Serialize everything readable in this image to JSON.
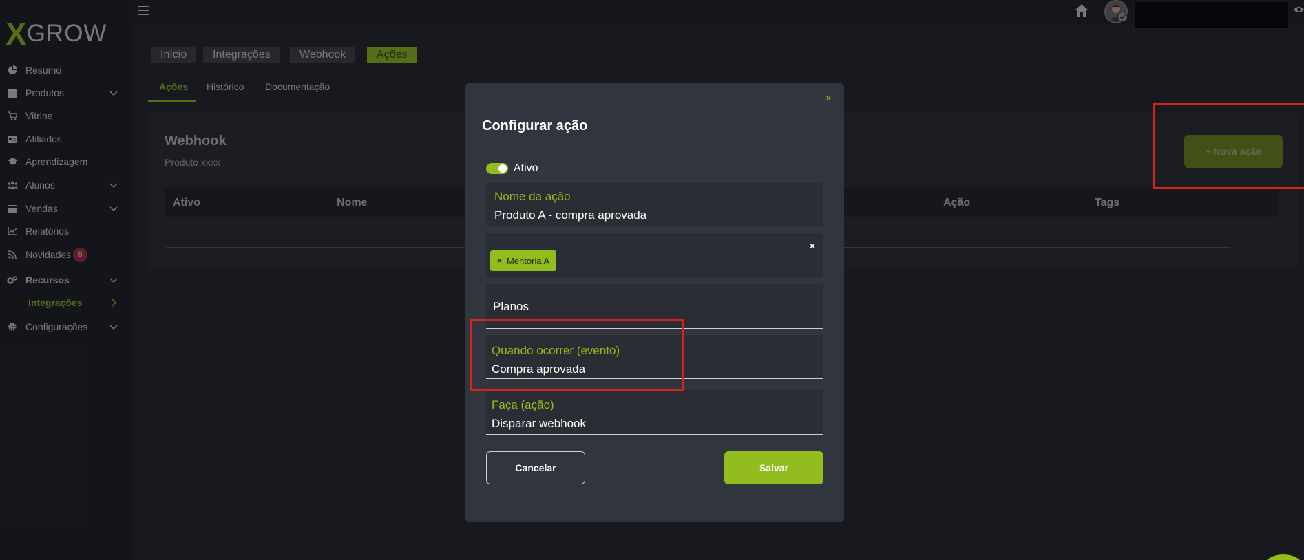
{
  "brand": {
    "logo_x": "X",
    "logo_rest": "GROW",
    "accent": "#93bc1e"
  },
  "sidebar": {
    "items": [
      {
        "label": "Resumo",
        "icon": "pie-chart-icon"
      },
      {
        "label": "Produtos",
        "icon": "box-icon"
      },
      {
        "label": "Vitrine",
        "icon": "cart-icon"
      },
      {
        "label": "Afiliados",
        "icon": "id-card-icon"
      },
      {
        "label": "Aprendizagem",
        "icon": "graduation-cap-icon"
      },
      {
        "label": "Alunos",
        "icon": "users-icon"
      },
      {
        "label": "Vendas",
        "icon": "wallet-icon"
      },
      {
        "label": "Relatórios",
        "icon": "line-chart-icon"
      },
      {
        "label": "Novidades",
        "icon": "rss-icon",
        "badge": "5"
      },
      {
        "label": "Recursos",
        "icon": "cogs-icon"
      },
      {
        "label": "Integrações"
      },
      {
        "label": "Configurações",
        "icon": "gear-icon"
      }
    ]
  },
  "breadcrumbs": [
    "Início",
    "Integrações",
    "Webhook",
    "Ações"
  ],
  "tabs": [
    "Ações",
    "Histórico",
    "Documentação"
  ],
  "card": {
    "title": "Webhook",
    "subtitle": "Produto xxxx",
    "columns": [
      "Ativo",
      "Nome",
      "Ação",
      "Tags"
    ],
    "new_action_button": "+ Nova ação"
  },
  "modal": {
    "title": "Configurar ação",
    "close": "×",
    "toggle_label": "Ativo",
    "toggle_on": true,
    "name_label": "Nome da ação",
    "name_value": "Produto A - compra aprovada",
    "chip_x": "×",
    "chip_label": "Mentoria A",
    "clear": "×",
    "plans_placeholder": "Planos",
    "event_label": "Quando ocorrer (evento)",
    "event_value": "Compra aprovada",
    "action_label": "Faça (ação)",
    "action_value": "Disparar webhook",
    "cancel": "Cancelar",
    "save": "Salvar"
  }
}
